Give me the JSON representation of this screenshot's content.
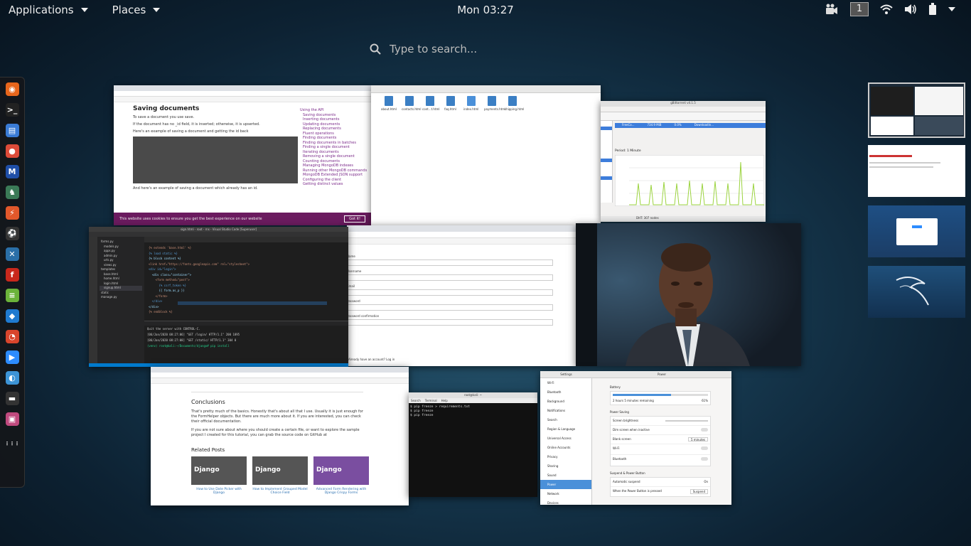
{
  "topbar": {
    "applications_label": "Applications",
    "places_label": "Places",
    "clock": "Mon 03:27",
    "workspace_number": "1"
  },
  "search": {
    "placeholder": "Type to search..."
  },
  "dock": {
    "apps": [
      {
        "name": "firefox-icon",
        "color": "#e8661c",
        "glyph": "◉"
      },
      {
        "name": "terminal-icon",
        "color": "#222",
        "glyph": ">_"
      },
      {
        "name": "files-icon",
        "color": "#3a7bd5",
        "glyph": "▤"
      },
      {
        "name": "chrome-icon",
        "color": "#dd4b39",
        "glyph": "●"
      },
      {
        "name": "malwarebytes-icon",
        "color": "#1f4fa8",
        "glyph": "M"
      },
      {
        "name": "ghidra-icon",
        "color": "#3b7a57",
        "glyph": "♞"
      },
      {
        "name": "burpsuite-icon",
        "color": "#e2582b",
        "glyph": "⚡"
      },
      {
        "name": "soccer-icon",
        "color": "#333",
        "glyph": "⚽"
      },
      {
        "name": "network-icon",
        "color": "#2a6fa8",
        "glyph": "✕"
      },
      {
        "name": "flash-icon",
        "color": "#c9281c",
        "glyph": "f"
      },
      {
        "name": "notes-icon",
        "color": "#6bb33a",
        "glyph": "≡"
      },
      {
        "name": "vscode-icon",
        "color": "#1f7ad0",
        "glyph": "◆"
      },
      {
        "name": "gauge-icon",
        "color": "#d9452c",
        "glyph": "◔"
      },
      {
        "name": "zoom-icon",
        "color": "#2d8cff",
        "glyph": "▶"
      },
      {
        "name": "remmina-icon",
        "color": "#3d94d6",
        "glyph": "◐"
      },
      {
        "name": "clapper-icon",
        "color": "#333",
        "glyph": "▬"
      },
      {
        "name": "app-icon",
        "color": "#c04a7e",
        "glyph": "▣"
      },
      {
        "name": "show-apps-icon",
        "color": "transparent",
        "glyph": "⋮⋮⋮"
      }
    ]
  },
  "windows": {
    "mongo_doc": {
      "heading": "Saving documents",
      "para1": "To save a document you use save.",
      "para2": "If the document has no _id field, it is inserted; otherwise, it is upserted.",
      "para3": "Here's an example of saving a document and getting the id back",
      "para4": "And here's an example of saving a document which already has an id.",
      "cookie_text": "This website uses cookies to ensure you get the best experience on our website",
      "cookie_button": "Got it!",
      "toc": [
        "Using the API",
        "Saving documents",
        "Inserting documents",
        "Updating documents",
        "Replacing documents",
        "Fluent operations",
        "Finding documents",
        "Finding documents in batches",
        "Finding a single document",
        "Iterating documents",
        "Removing a single document",
        "Counting documents",
        "Managing MongoDB indexes",
        "Running other MongoDB commands",
        "MongoDB Extended JSON support",
        "Configuring the client",
        "Getting distinct values"
      ]
    },
    "files": {
      "items": [
        "about.html",
        "contacts.html",
        "cont...t.html",
        "faq.html",
        "index.html",
        "payments.html",
        "shipping.html"
      ]
    },
    "monitor": {
      "title": "gBittorrent v4.1.5",
      "period": "Period: 1 Minute",
      "rows": [
        {
          "name": "FreeCo...",
          "size": "734.9 MiB",
          "done": "0.0%",
          "status": "Downloadin..."
        }
      ],
      "status_bar": "DHT: 307 nodes"
    },
    "vscode": {
      "title": "sign.html - root - rns - Visual Studio Code [Superuser]",
      "files": [
        "forms.py",
        "models.py",
        "apps.py",
        "admin.py",
        "urls.py",
        "views.py",
        "templates",
        "base.html",
        "home.html",
        "login.html",
        "signup.html",
        "static",
        "manage.py"
      ],
      "code_lines": [
        "{% extends 'base.html' %}",
        "{% load static %}",
        "{% block content %}",
        "<link href=\"https://fonts.googleapis.com\" rel=\"stylesheet\">",
        "<div id=\"login\">",
        "  <div class=\"container\">",
        "    <form method=\"post\">",
        "      {% csrf_token %}",
        "      {{ form.as_p }}",
        "    </form>",
        "  </div>",
        "</div>",
        "{% endblock %}"
      ],
      "terminal_lines": [
        "Quit the server with CONTROL-C.",
        "[06/Jan/2020 08:27:06] \"GET /login/ HTTP/1.1\" 200 1895",
        "[06/Jan/2020 08:27:08] \"GET /static/ HTTP/1.1\" 304 0",
        "(venv) root@kali:~/Documents/django# pip install"
      ]
    },
    "browser_form": {
      "fields": [
        "Name",
        "Username",
        "Email",
        "Password",
        "Password confirmation"
      ],
      "footer": "Already have an account? Log in"
    },
    "blog": {
      "heading": "Conclusions",
      "para1": "That's pretty much of the basics. Honestly that's about all that I use. Usually it is just enough for the FormHelper objects. But there are much more about it. If you are interested, you can check their official documentation.",
      "para2": "If you are not sure about where you should create a certain file, or want to explore the sample project I created for this tutorial, you can grab the source code on GitHub at",
      "related_title": "Related Posts",
      "related": [
        {
          "thumb": "Django",
          "caption": "How to Use Date Picker with Django"
        },
        {
          "thumb": "Django",
          "caption": "How to Implement Grouped Model Choice Field"
        },
        {
          "thumb": "Django",
          "caption": "Advanced Form Rendering with Django Crispy Forms"
        }
      ]
    },
    "terminal": {
      "title": "root@kali: ~",
      "menu": [
        "Search",
        "Terminal",
        "Help"
      ],
      "lines": [
        "$ pip freeze > requirements.txt",
        "$ pip freeze",
        "$ pip freeze"
      ]
    },
    "settings": {
      "title": "Settings",
      "panel_title": "Power",
      "sidebar": [
        "Wi-Fi",
        "Bluetooth",
        "Background",
        "Notifications",
        "Search",
        "Region & Language",
        "Universal Access",
        "Online Accounts",
        "Privacy",
        "Sharing",
        "Sound",
        "Power",
        "Network",
        "Devices"
      ],
      "battery_label": "Battery",
      "battery_text": "2 hours 5 minutes remaining",
      "battery_pct": "61%",
      "power_saving": "Power Saving",
      "screen_brightness": "Screen brightness",
      "dim_screen": "Dim screen when inactive",
      "blank_screen": "Blank screen",
      "blank_value": "5 minutes",
      "wifi": "Wi-Fi",
      "bluetooth": "Bluetooth",
      "suspend_title": "Suspend & Power Button",
      "auto_suspend": "Automatic suspend",
      "auto_suspend_value": "On",
      "power_button": "When the Power Button is pressed",
      "power_button_value": "Suspend"
    }
  }
}
